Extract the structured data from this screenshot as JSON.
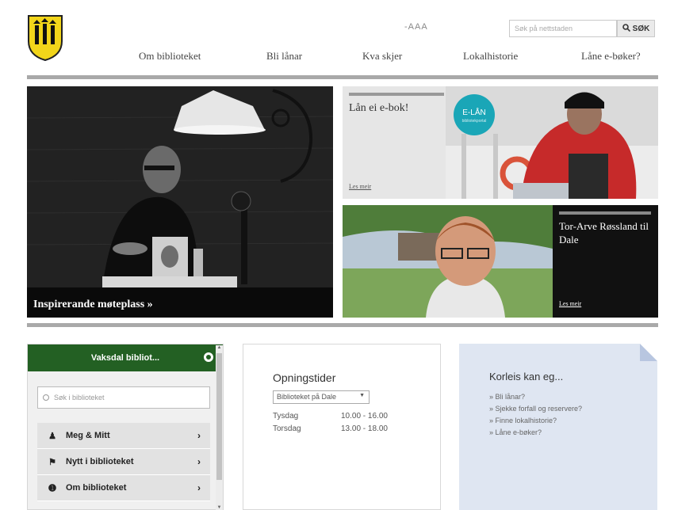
{
  "header": {
    "text_size": "-AAA",
    "search": {
      "placeholder": "Søk på nettstaden",
      "button_label": "SØK"
    },
    "nav": [
      "Om biblioteket",
      "Bli lånar",
      "Kva skjer",
      "Lokalhistorie",
      "Låne e-bøker?"
    ]
  },
  "hero": {
    "main_caption": "Inspirerande møteplass »",
    "ebok": {
      "title": "Lån ei e-bok!",
      "more": "Les meir",
      "badge": "E-LÅN",
      "badge_sub": "bibliotekportal"
    },
    "tor": {
      "title": "Tor-Arve Røssland til Dale",
      "more": "Les meir"
    }
  },
  "widget": {
    "title": "Vaksdal bibliot...",
    "search_placeholder": "Søk i biblioteket",
    "items": [
      {
        "label": "Meg & Mitt",
        "icon": "user-icon"
      },
      {
        "label": "Nytt i biblioteket",
        "icon": "megaphone-icon"
      },
      {
        "label": "Om biblioteket",
        "icon": "info-icon"
      }
    ]
  },
  "hours": {
    "title": "Opningstider",
    "select_value": "Biblioteket på Dale",
    "rows": [
      {
        "day": "Tysdag",
        "time": "10.00 - 16.00"
      },
      {
        "day": "Torsdag",
        "time": "13.00 - 18.00"
      }
    ]
  },
  "korleis": {
    "title": "Korleis kan eg...",
    "links": [
      "Bli lånar?",
      "Sjekke forfall og reservere?",
      "Finne lokalhistorie?",
      "Låne e-bøker?"
    ]
  },
  "colors": {
    "green": "#236023",
    "grey_rule": "#a9a9a9",
    "light_blue": "#dfe6f2",
    "teal": "#1aa6b7"
  }
}
